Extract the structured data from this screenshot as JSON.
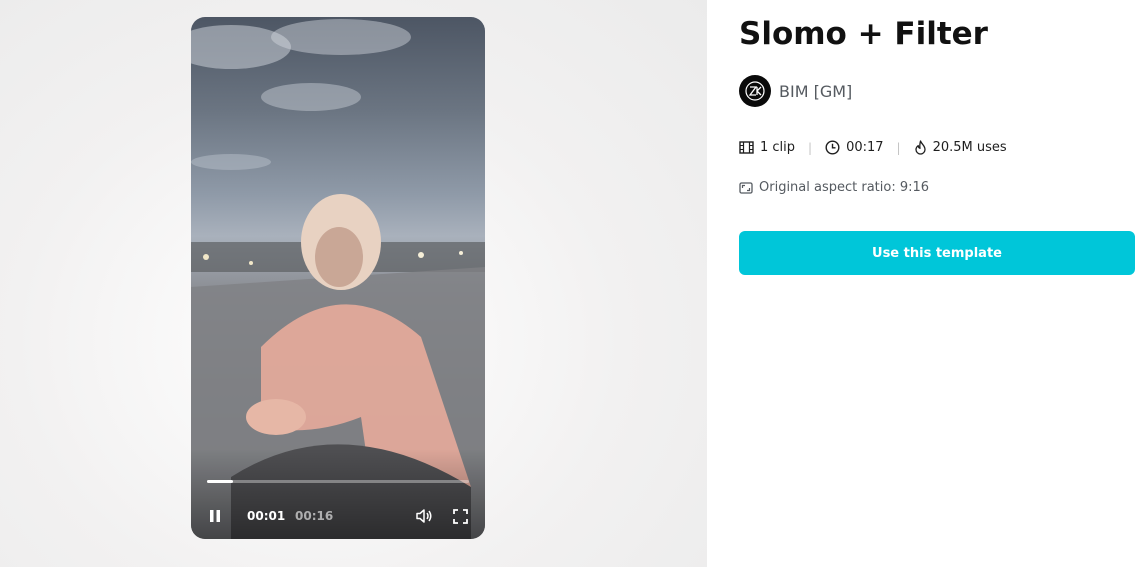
{
  "template": {
    "title": "Slomo + Filter",
    "author": {
      "name": "BIM [GM]",
      "avatar_icon": "zk-monogram-icon"
    },
    "stats": {
      "clips": "1 clip",
      "duration": "00:17",
      "uses": "20.5M uses"
    },
    "aspect_ratio": "Original aspect ratio: 9:16",
    "cta_label": "Use this template"
  },
  "player": {
    "current_time": "00:01",
    "total_time": "00:16",
    "progress_fraction": 0.1,
    "state": "playing"
  },
  "colors": {
    "accent": "#00c6d9",
    "title": "#111111",
    "muted_text": "#555a60"
  }
}
